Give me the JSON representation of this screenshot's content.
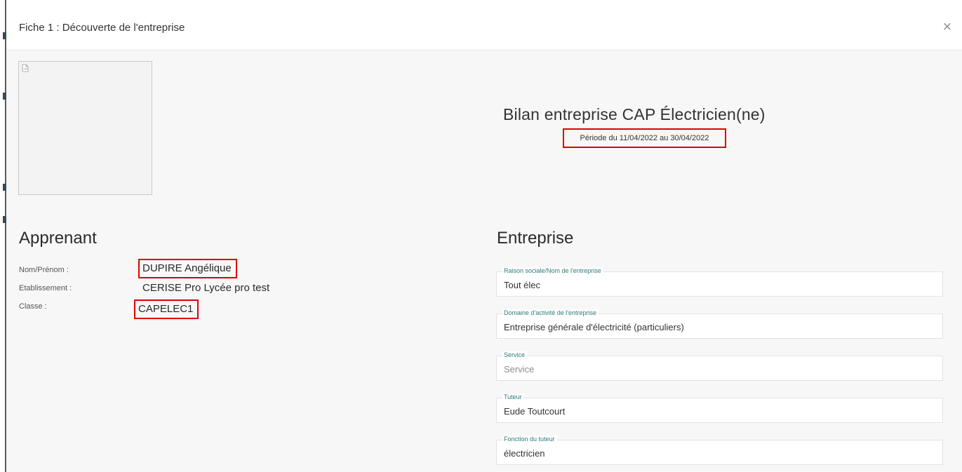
{
  "modal": {
    "title": "Fiche 1 : Découverte de l'entreprise",
    "close_label": "×"
  },
  "report": {
    "title": "Bilan entreprise CAP Électricien(ne)",
    "period": "Période du 11/04/2022 au 30/04/2022"
  },
  "learner": {
    "section_title": "Apprenant",
    "rows": [
      {
        "label": "Nom/Prénom :",
        "value": "DUPIRE Angélique"
      },
      {
        "label": "Etablissement :",
        "value": "CERISE Pro Lycée pro test"
      },
      {
        "label": "Classe :",
        "value": "CAPELEC1"
      }
    ]
  },
  "company": {
    "section_title": "Entreprise",
    "fields": [
      {
        "label": "Raison sociale/Nom de l'entreprise",
        "value": "Tout élec",
        "placeholder": ""
      },
      {
        "label": "Domaine d'activité de l'entreprise",
        "value": "Entreprise générale d'électricité (particuliers)",
        "placeholder": ""
      },
      {
        "label": "Service",
        "value": "",
        "placeholder": "Service"
      },
      {
        "label": "Tuteur",
        "value": "Eude Toutcourt",
        "placeholder": ""
      },
      {
        "label": "Fonction du tuteur",
        "value": "électricien",
        "placeholder": ""
      }
    ]
  },
  "colors": {
    "highlight": "#e00000",
    "field_label": "#2e7a7a"
  }
}
